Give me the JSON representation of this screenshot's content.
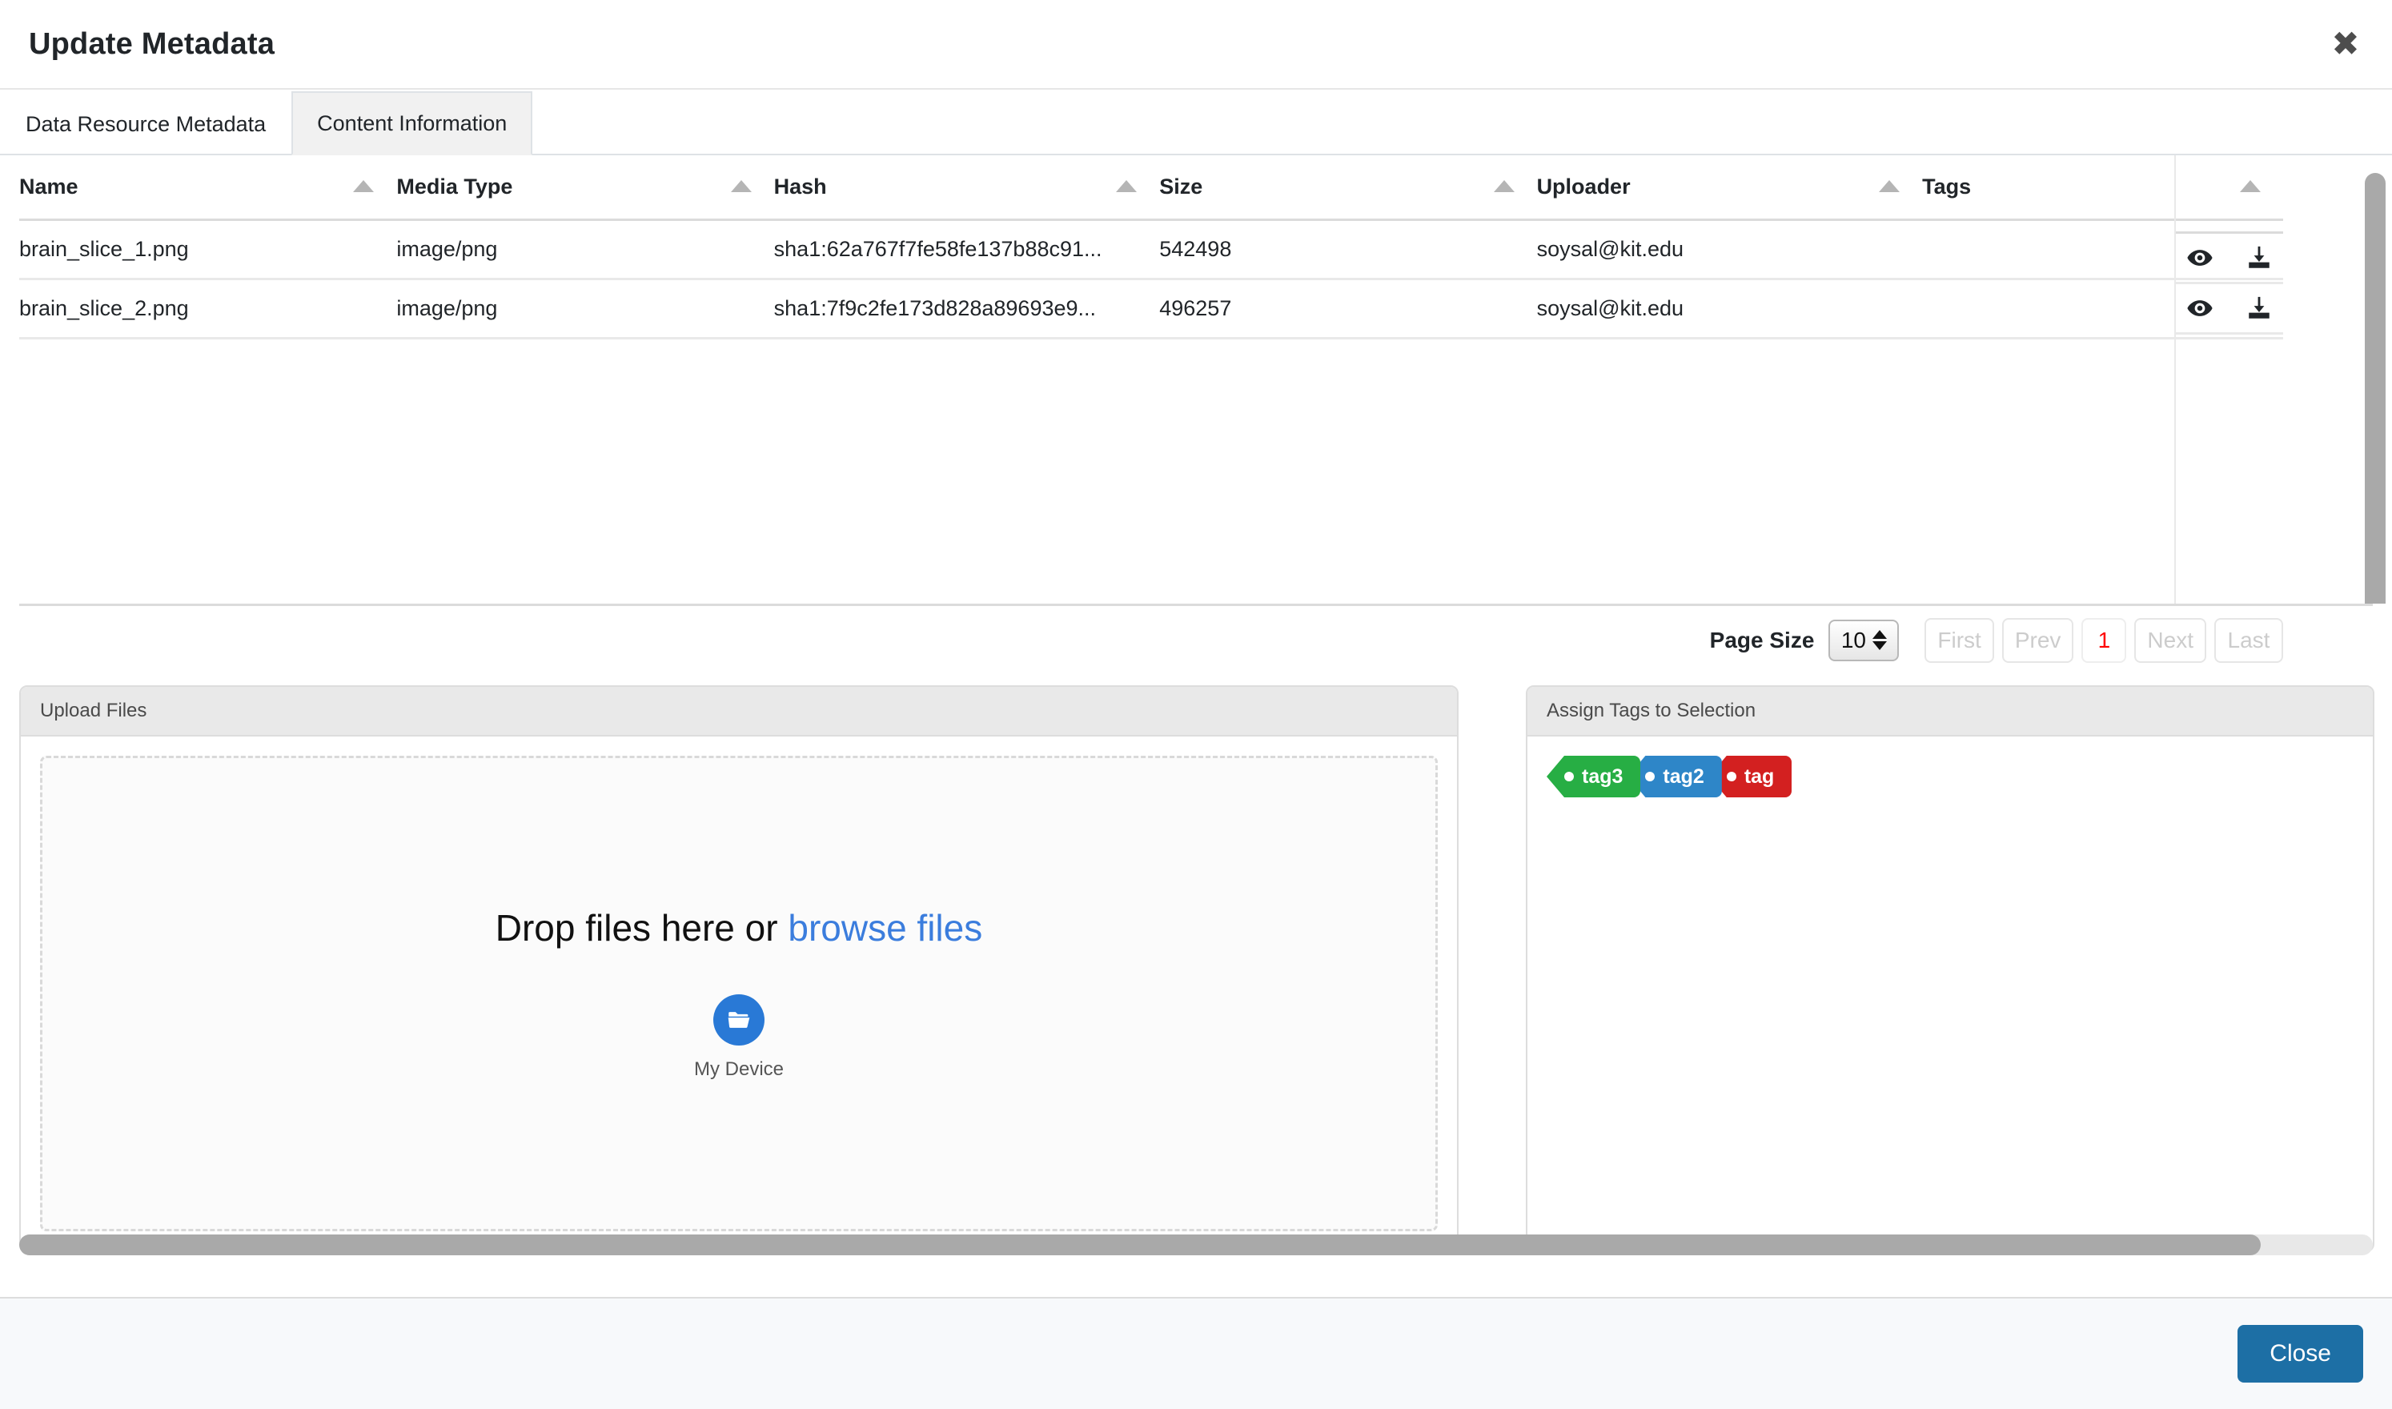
{
  "header": {
    "title": "Update Metadata",
    "close_icon": "close-icon"
  },
  "tabs": [
    {
      "label": "Data Resource Metadata",
      "active": false
    },
    {
      "label": "Content Information",
      "active": true
    }
  ],
  "table": {
    "columns": [
      {
        "key": "name",
        "label": "Name",
        "sort_icon": "sort-ascending-icon"
      },
      {
        "key": "media_type",
        "label": "Media Type",
        "sort_icon": "sort-ascending-icon"
      },
      {
        "key": "hash",
        "label": "Hash",
        "sort_icon": "sort-ascending-icon"
      },
      {
        "key": "size",
        "label": "Size",
        "sort_icon": "sort-ascending-icon"
      },
      {
        "key": "uploader",
        "label": "Uploader",
        "sort_icon": "sort-ascending-icon"
      },
      {
        "key": "tags",
        "label": "Tags",
        "sort_icon": "sort-ascending-icon"
      }
    ],
    "rows": [
      {
        "name": "brain_slice_1.png",
        "media_type": "image/png",
        "hash": "sha1:62a767f7fe58fe137b88c91...",
        "size": "542498",
        "uploader": "soysal@kit.edu",
        "tags": "",
        "actions": [
          "eye-icon",
          "download-icon"
        ]
      },
      {
        "name": "brain_slice_2.png",
        "media_type": "image/png",
        "hash": "sha1:7f9c2fe173d828a89693e9...",
        "size": "496257",
        "uploader": "soysal@kit.edu",
        "tags": "",
        "actions": [
          "eye-icon",
          "download-icon"
        ]
      }
    ]
  },
  "pagination": {
    "page_size_label": "Page Size",
    "page_size_value": "10",
    "first_label": "First",
    "prev_label": "Prev",
    "current_page": "1",
    "next_label": "Next",
    "last_label": "Last",
    "current_page_color": "#ff0000",
    "disabled_color": "#cccccc"
  },
  "upload_panel": {
    "title": "Upload Files",
    "drop_text": "Drop files here or ",
    "browse_link": "browse files",
    "device_label": "My Device",
    "device_icon": "folder-open-icon",
    "link_color": "#3b7ddd",
    "device_circle_color": "#2979d6"
  },
  "tags_panel": {
    "title": "Assign Tags to Selection",
    "tags": [
      {
        "label": "tag3",
        "color": "#27ae44"
      },
      {
        "label": "tag2",
        "color": "#2e86c8"
      },
      {
        "label": "tag",
        "color": "#d32020"
      }
    ]
  },
  "footer": {
    "close_label": "Close",
    "close_color": "#1d6fa5"
  }
}
